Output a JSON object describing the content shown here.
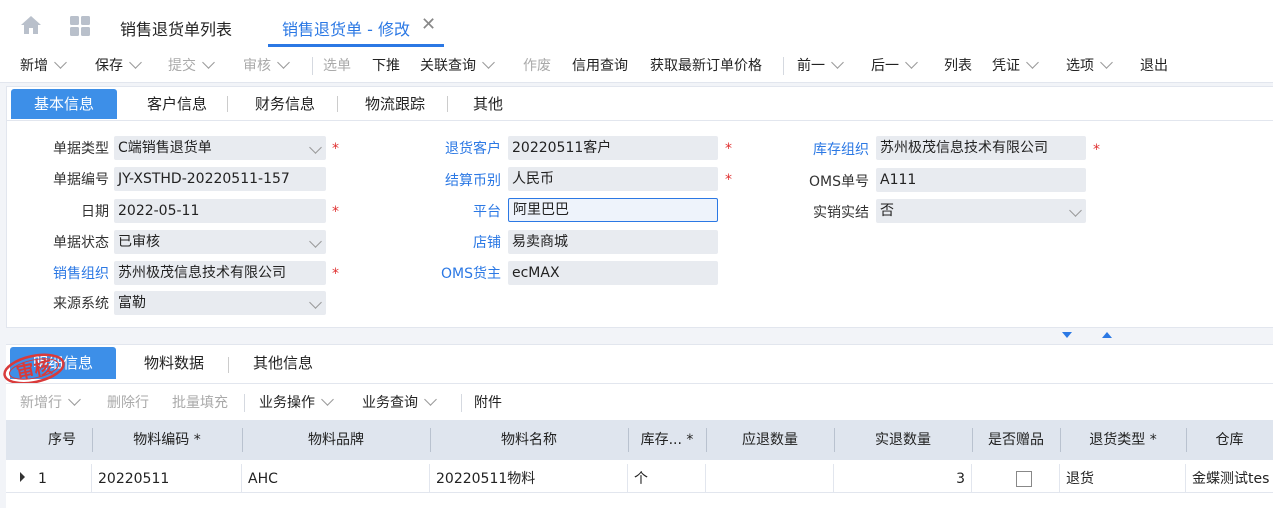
{
  "top_tabs": {
    "list_label": "销售退货单列表",
    "active_label": "销售退货单 - 修改"
  },
  "toolbar": {
    "items": [
      "新增",
      "保存",
      "提交",
      "审核",
      "选单",
      "下推",
      "关联查询",
      "作废",
      "信用查询",
      "获取最新订单价格",
      "前一",
      "后一",
      "列表",
      "凭证",
      "选项",
      "退出"
    ]
  },
  "header_tabs": [
    "基本信息",
    "客户信息",
    "财务信息",
    "物流跟踪",
    "其他"
  ],
  "form": {
    "doc_type_label": "单据类型",
    "doc_type": "C端销售退货单",
    "doc_no_label": "单据编号",
    "doc_no": "JY-XSTHD-20220511-157",
    "date_label": "日期",
    "date": "2022-05-11",
    "status_label": "单据状态",
    "status": "已审核",
    "sales_org_label": "销售组织",
    "sales_org": "苏州极茂信息技术有限公司",
    "source_label": "来源系统",
    "source": "富勒",
    "return_customer_label": "退货客户",
    "return_customer": "20220511客户",
    "currency_label": "结算币别",
    "currency": "人民币",
    "platform_label": "平台",
    "platform": "阿里巴巴",
    "shop_label": "店铺",
    "shop": "易卖商城",
    "oms_owner_label": "OMS货主",
    "oms_owner": "ecMAX",
    "stock_org_label": "库存组织",
    "stock_org": "苏州极茂信息技术有限公司",
    "oms_no_label": "OMS单号",
    "oms_no": "A111",
    "sold_label": "实销实结",
    "sold": "否",
    "required_mark": "*"
  },
  "detail_tabs": [
    "明细信息",
    "物料数据",
    "其他信息"
  ],
  "detail_toolbar": [
    "新增行",
    "删除行",
    "批量填充",
    "业务操作",
    "业务查询",
    "附件"
  ],
  "stamp_text": "审核",
  "grid": {
    "headers": [
      "序号",
      "物料编码 *",
      "物料品牌",
      "物料名称",
      "库存... *",
      "应退数量",
      "实退数量",
      "是否赠品",
      "退货类型 *",
      "仓库"
    ],
    "row": {
      "seq": "1",
      "code": "20220511",
      "brand": "AHC",
      "name": "20220511物料",
      "unit": "个",
      "should_qty": "",
      "actual_qty": "3",
      "gift": "",
      "return_type": "退货",
      "warehouse": "金蝶测试tes"
    }
  }
}
